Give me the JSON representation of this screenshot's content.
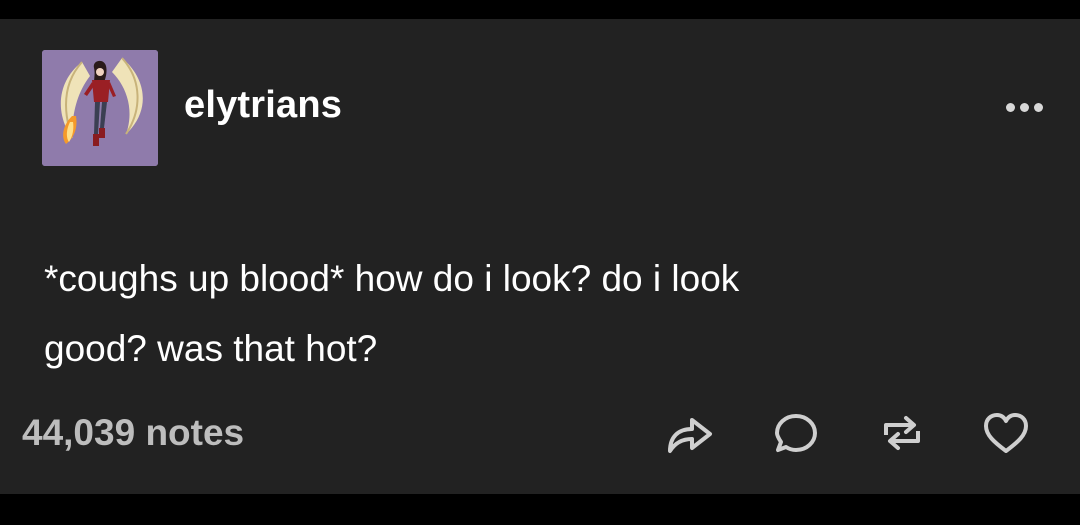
{
  "post": {
    "username": "elytrians",
    "body_lines": [
      "*coughs up blood* how do i look? do i look",
      "good? was that hot?"
    ],
    "notes_label": "44,039 notes"
  },
  "icons": {
    "more": "more-horizontal-icon",
    "share": "share-icon",
    "reply": "reply-icon",
    "reblog": "reblog-icon",
    "like": "heart-icon"
  },
  "colors": {
    "background": "#222222",
    "frame": "#000000",
    "text": "#ffffff",
    "muted": "#bdbdbd",
    "avatar_bg": "#8f7bab"
  }
}
